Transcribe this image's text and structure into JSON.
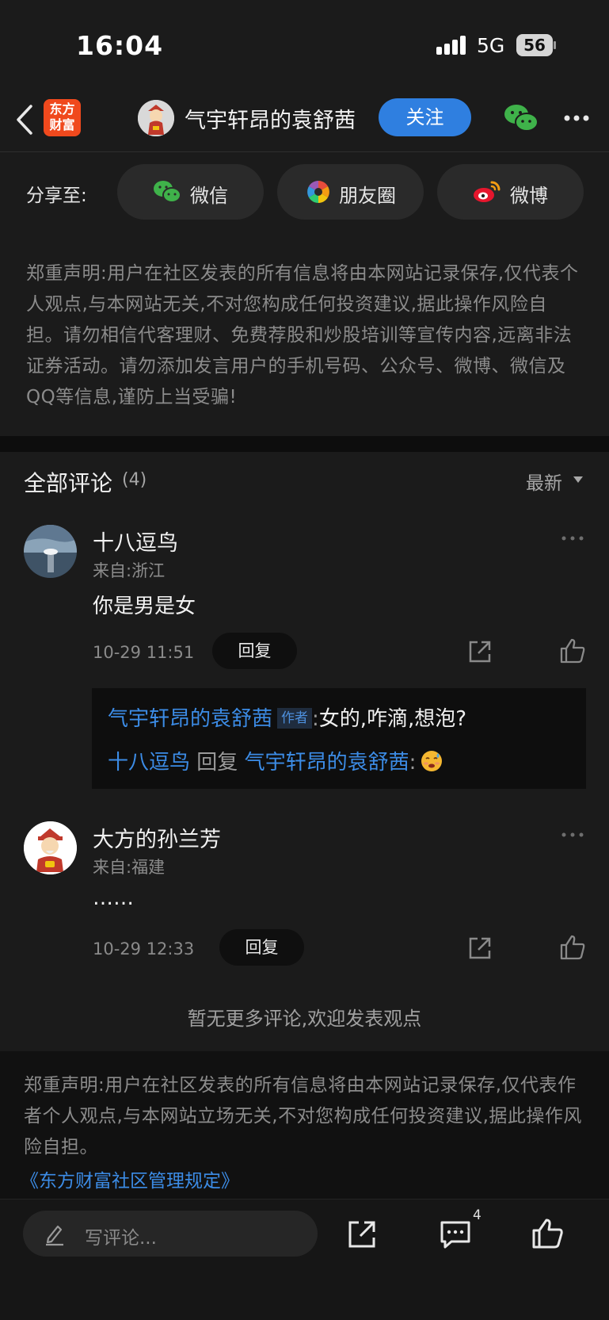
{
  "status_bar": {
    "time": "16:04",
    "network": "5G",
    "battery": "56"
  },
  "nav": {
    "back_icon": "chevron-left-icon",
    "logo_line1": "东方",
    "logo_line2": "财富",
    "author_name": "气宇轩昂的袁舒茜",
    "follow_label": "关注",
    "wechat_icon": "wechat-icon",
    "more_icon": "more-dots-icon"
  },
  "share": {
    "label": "分享至:",
    "targets": [
      {
        "label": "微信",
        "icon": "wechat-icon"
      },
      {
        "label": "朋友圈",
        "icon": "moments-icon"
      },
      {
        "label": "微博",
        "icon": "weibo-icon"
      }
    ]
  },
  "notice_top": "郑重声明:用户在社区发表的所有信息将由本网站记录保存,仅代表个人观点,与本网站无关,不对您构成任何投资建议,据此操作风险自担。请勿相信代客理财、免费荐股和炒股培训等宣传内容,远离非法证券活动。请勿添加发言用户的手机号码、公众号、微博、微信及QQ等信息,谨防上当受骗!",
  "comments": {
    "title": "全部评论",
    "count": "(4)",
    "sort_label": "最新",
    "items": [
      {
        "name": "十八逗鸟",
        "location": "来自:浙江",
        "text": "你是男是女",
        "time": "10-29 11:51",
        "reply_label": "回复"
      },
      {
        "name": "大方的孙兰芳",
        "location": "来自:福建",
        "text": "……",
        "time": "10-29 12:33",
        "reply_label": "回复"
      }
    ],
    "replies": {
      "line1_user": "气宇轩昂的袁舒茜",
      "line1_tag": "作者",
      "line1_colon": ":",
      "line1_text": "女的,咋滴,想泡?",
      "line2_user": "十八逗鸟",
      "line2_verb": "回复",
      "line2_target": "气宇轩昂的袁舒茜",
      "line2_colon": ":"
    },
    "no_more": "暂无更多评论,欢迎发表观点"
  },
  "notice_bottom": {
    "text": "郑重声明:用户在社区发表的所有信息将由本网站记录保存,仅代表作者个人观点,与本网站立场无关,不对您构成任何投资建议,据此操作风险自担。",
    "rules_link": "《东方财富社区管理规定》"
  },
  "bottom_bar": {
    "input_placeholder": "写评论...",
    "comment_count": "4"
  },
  "colors": {
    "background": "#1b1b1b",
    "accent_blue": "#2f7fe0",
    "link_blue": "#3c8ce6",
    "logo_orange": "#f0491d"
  }
}
